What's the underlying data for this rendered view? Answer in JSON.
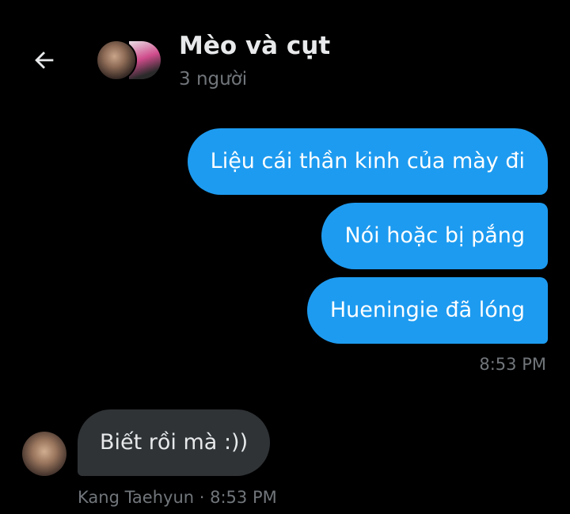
{
  "header": {
    "back_icon": "arrow-left-icon",
    "title": "Mèo và cụt",
    "subtitle": "3 người"
  },
  "messages_outgoing": [
    {
      "text": "Liệu cái thần kinh của mày đi"
    },
    {
      "text": "Nói hoặc bị pắng"
    },
    {
      "text": "Hueningie đã lóng"
    }
  ],
  "outgoing_time": "8:53 PM",
  "incoming": {
    "text": "Biết rồi mà :))",
    "sender": "Kang Taehyun",
    "separator": " · ",
    "time": "8:53 PM"
  },
  "colors": {
    "background": "#000000",
    "outgoing_bubble": "#1d9bf0",
    "incoming_bubble": "#2f3336",
    "muted_text": "#71767b"
  }
}
